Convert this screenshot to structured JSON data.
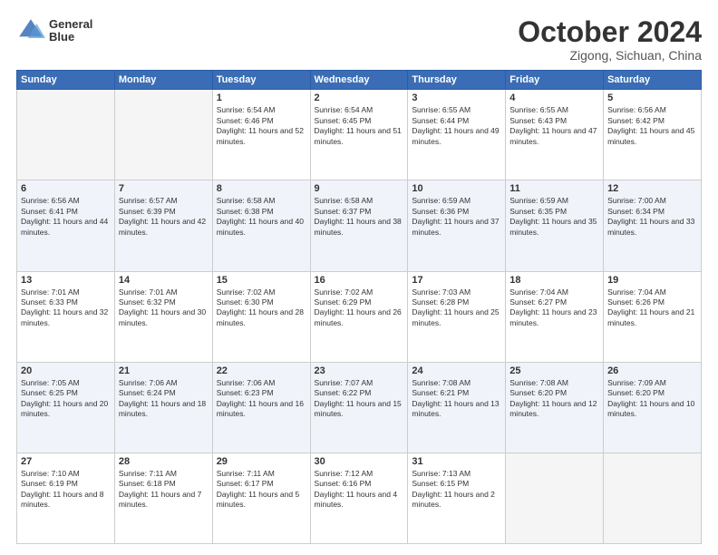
{
  "header": {
    "logo_line1": "General",
    "logo_line2": "Blue",
    "month": "October 2024",
    "location": "Zigong, Sichuan, China"
  },
  "weekdays": [
    "Sunday",
    "Monday",
    "Tuesday",
    "Wednesday",
    "Thursday",
    "Friday",
    "Saturday"
  ],
  "weeks": [
    [
      {
        "day": "",
        "info": ""
      },
      {
        "day": "",
        "info": ""
      },
      {
        "day": "1",
        "info": "Sunrise: 6:54 AM\nSunset: 6:46 PM\nDaylight: 11 hours and 52 minutes."
      },
      {
        "day": "2",
        "info": "Sunrise: 6:54 AM\nSunset: 6:45 PM\nDaylight: 11 hours and 51 minutes."
      },
      {
        "day": "3",
        "info": "Sunrise: 6:55 AM\nSunset: 6:44 PM\nDaylight: 11 hours and 49 minutes."
      },
      {
        "day": "4",
        "info": "Sunrise: 6:55 AM\nSunset: 6:43 PM\nDaylight: 11 hours and 47 minutes."
      },
      {
        "day": "5",
        "info": "Sunrise: 6:56 AM\nSunset: 6:42 PM\nDaylight: 11 hours and 45 minutes."
      }
    ],
    [
      {
        "day": "6",
        "info": "Sunrise: 6:56 AM\nSunset: 6:41 PM\nDaylight: 11 hours and 44 minutes."
      },
      {
        "day": "7",
        "info": "Sunrise: 6:57 AM\nSunset: 6:39 PM\nDaylight: 11 hours and 42 minutes."
      },
      {
        "day": "8",
        "info": "Sunrise: 6:58 AM\nSunset: 6:38 PM\nDaylight: 11 hours and 40 minutes."
      },
      {
        "day": "9",
        "info": "Sunrise: 6:58 AM\nSunset: 6:37 PM\nDaylight: 11 hours and 38 minutes."
      },
      {
        "day": "10",
        "info": "Sunrise: 6:59 AM\nSunset: 6:36 PM\nDaylight: 11 hours and 37 minutes."
      },
      {
        "day": "11",
        "info": "Sunrise: 6:59 AM\nSunset: 6:35 PM\nDaylight: 11 hours and 35 minutes."
      },
      {
        "day": "12",
        "info": "Sunrise: 7:00 AM\nSunset: 6:34 PM\nDaylight: 11 hours and 33 minutes."
      }
    ],
    [
      {
        "day": "13",
        "info": "Sunrise: 7:01 AM\nSunset: 6:33 PM\nDaylight: 11 hours and 32 minutes."
      },
      {
        "day": "14",
        "info": "Sunrise: 7:01 AM\nSunset: 6:32 PM\nDaylight: 11 hours and 30 minutes."
      },
      {
        "day": "15",
        "info": "Sunrise: 7:02 AM\nSunset: 6:30 PM\nDaylight: 11 hours and 28 minutes."
      },
      {
        "day": "16",
        "info": "Sunrise: 7:02 AM\nSunset: 6:29 PM\nDaylight: 11 hours and 26 minutes."
      },
      {
        "day": "17",
        "info": "Sunrise: 7:03 AM\nSunset: 6:28 PM\nDaylight: 11 hours and 25 minutes."
      },
      {
        "day": "18",
        "info": "Sunrise: 7:04 AM\nSunset: 6:27 PM\nDaylight: 11 hours and 23 minutes."
      },
      {
        "day": "19",
        "info": "Sunrise: 7:04 AM\nSunset: 6:26 PM\nDaylight: 11 hours and 21 minutes."
      }
    ],
    [
      {
        "day": "20",
        "info": "Sunrise: 7:05 AM\nSunset: 6:25 PM\nDaylight: 11 hours and 20 minutes."
      },
      {
        "day": "21",
        "info": "Sunrise: 7:06 AM\nSunset: 6:24 PM\nDaylight: 11 hours and 18 minutes."
      },
      {
        "day": "22",
        "info": "Sunrise: 7:06 AM\nSunset: 6:23 PM\nDaylight: 11 hours and 16 minutes."
      },
      {
        "day": "23",
        "info": "Sunrise: 7:07 AM\nSunset: 6:22 PM\nDaylight: 11 hours and 15 minutes."
      },
      {
        "day": "24",
        "info": "Sunrise: 7:08 AM\nSunset: 6:21 PM\nDaylight: 11 hours and 13 minutes."
      },
      {
        "day": "25",
        "info": "Sunrise: 7:08 AM\nSunset: 6:20 PM\nDaylight: 11 hours and 12 minutes."
      },
      {
        "day": "26",
        "info": "Sunrise: 7:09 AM\nSunset: 6:20 PM\nDaylight: 11 hours and 10 minutes."
      }
    ],
    [
      {
        "day": "27",
        "info": "Sunrise: 7:10 AM\nSunset: 6:19 PM\nDaylight: 11 hours and 8 minutes."
      },
      {
        "day": "28",
        "info": "Sunrise: 7:11 AM\nSunset: 6:18 PM\nDaylight: 11 hours and 7 minutes."
      },
      {
        "day": "29",
        "info": "Sunrise: 7:11 AM\nSunset: 6:17 PM\nDaylight: 11 hours and 5 minutes."
      },
      {
        "day": "30",
        "info": "Sunrise: 7:12 AM\nSunset: 6:16 PM\nDaylight: 11 hours and 4 minutes."
      },
      {
        "day": "31",
        "info": "Sunrise: 7:13 AM\nSunset: 6:15 PM\nDaylight: 11 hours and 2 minutes."
      },
      {
        "day": "",
        "info": ""
      },
      {
        "day": "",
        "info": ""
      }
    ]
  ]
}
